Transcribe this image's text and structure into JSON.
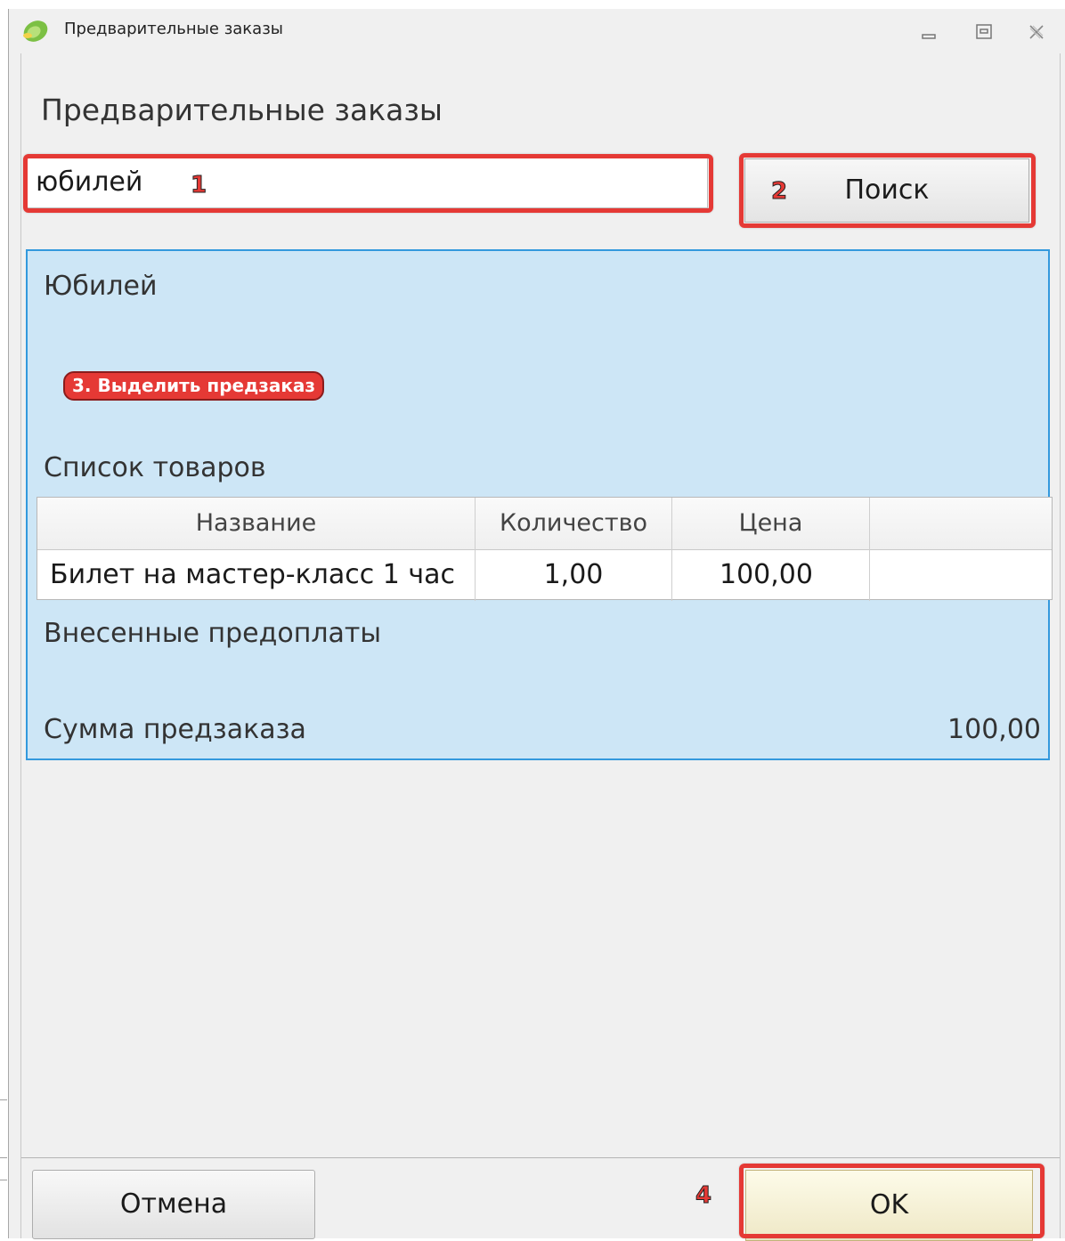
{
  "window": {
    "title": "Предварительные заказы",
    "controls": [
      "minimize-icon",
      "maximize-icon",
      "close-icon"
    ]
  },
  "main": {
    "heading": "Предварительные заказы",
    "search": {
      "value": "юбилей",
      "button_label": "Поиск"
    },
    "order": {
      "name": "Юбилей",
      "note": "3. Выделить предзаказ",
      "items_label": "Список товаров",
      "columns": [
        "Название",
        "Количество",
        "Цена",
        ""
      ],
      "rows": [
        {
          "name": "Билет на мастер-класс 1 час",
          "qty": "1,00",
          "price": "100,00",
          "extra": ""
        }
      ],
      "prepayments_label": "Внесенные предоплаты",
      "total_label": "Сумма предзаказа",
      "total_value": "100,00"
    }
  },
  "footer": {
    "cancel_label": "Отмена",
    "ok_label": "OK"
  },
  "annotations": {
    "n1": "1",
    "n2": "2",
    "n4": "4"
  },
  "colors": {
    "selection": "#cde6f6",
    "selection_border": "#3399dd",
    "callout": "#e53935"
  }
}
